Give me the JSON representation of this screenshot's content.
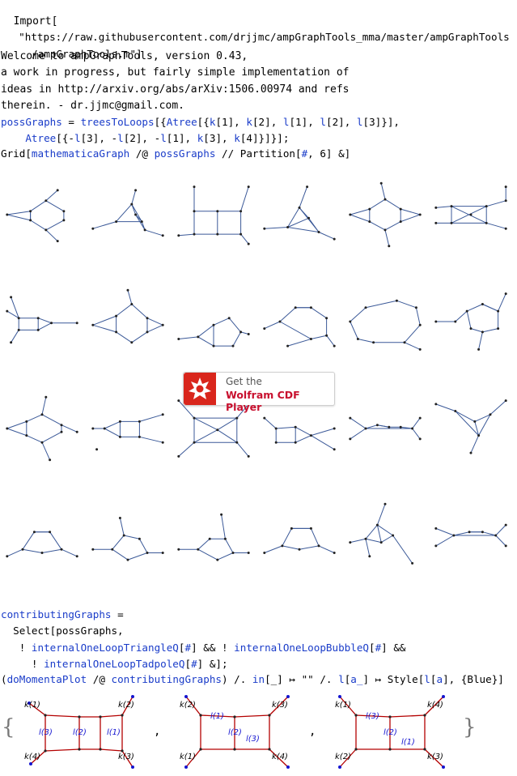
{
  "code": {
    "import_keyword": "Import[",
    "import_url_1": "\"https://raw.githubusercontent.com/drjjmc/ampGraphTools_mma/master/ampGraphTools",
    "import_url_2": "/ampGraphTools.m\"]",
    "welcome_1": "Welcome to ampGraphTools, version 0.43,",
    "welcome_2": "a work in progress, but fairly simple implementation of",
    "welcome_3": "ideas in http://arxiv.org/abs/arXiv:1506.00974 and refs",
    "welcome_4": "therein. - dr.jjmc@gmail.com.",
    "poss_1_a": "possGraphs",
    "poss_1_b": " = ",
    "poss_1_c": "treesToLoops",
    "poss_1_d": "[{",
    "poss_1_e": "Atree",
    "poss_1_f": "[{",
    "poss_1_g": "k",
    "poss_1_h": "[1], ",
    "poss_1_i": "k",
    "poss_1_j": "[2], ",
    "poss_1_k": "l",
    "poss_1_l": "[1], ",
    "poss_1_m": "l",
    "poss_1_n": "[2], ",
    "poss_1_o": "l",
    "poss_1_p": "[3]}],",
    "poss_2_a": "    Atree",
    "poss_2_b": "[{-",
    "poss_2_c": "l",
    "poss_2_d": "[3], -",
    "poss_2_e": "l",
    "poss_2_f": "[2], -",
    "poss_2_g": "l",
    "poss_2_h": "[1], ",
    "poss_2_i": "k",
    "poss_2_j": "[3], ",
    "poss_2_k": "k",
    "poss_2_l": "[4]}]}];",
    "grid_a": "Grid[",
    "grid_b": "mathematicaGraph",
    "grid_c": " /@ ",
    "grid_d": "possGraphs",
    "grid_e": " // Partition[",
    "grid_f": "#",
    "grid_g": ", 6] &]",
    "contrib_1_a": "contributingGraphs",
    "contrib_1_b": " =",
    "contrib_2": "  Select[possGraphs,",
    "contrib_3_a": "   ! ",
    "contrib_3_b": "internalOneLoopTriangleQ",
    "contrib_3_c": "[",
    "contrib_3_d": "#",
    "contrib_3_e": "] && ! ",
    "contrib_3_f": "internalOneLoopBubbleQ",
    "contrib_3_g": "[",
    "contrib_3_h": "#",
    "contrib_3_i": "] &&",
    "contrib_4_a": "     ! ",
    "contrib_4_b": "internalOneLoopTadpoleQ",
    "contrib_4_c": "[",
    "contrib_4_d": "#",
    "contrib_4_e": "] &];",
    "plot_a": "(",
    "plot_b": "doMomentaPlot",
    "plot_c": " /@ ",
    "plot_d": "contributingGraphs",
    "plot_e": ") /. ",
    "plot_f": "in",
    "plot_g": "[_] ↦ \"\" /. ",
    "plot_h": "l",
    "plot_i": "[",
    "plot_j": "a_",
    "plot_k": "] ↦ Style[",
    "plot_l": "l",
    "plot_m": "[",
    "plot_n": "a",
    "plot_o": "], {Blue}]"
  },
  "cdf_player": {
    "line1": "Get the",
    "line2": "Wolfram CDF Player"
  },
  "momenta_output": {
    "open_brace": "{",
    "close_brace": "}",
    "comma": ",",
    "plots": [
      {
        "k_labels": [
          "k(1)",
          "k(2)",
          "k(4)",
          "k(3)"
        ],
        "l_labels": [
          "l(3)",
          "l(2)",
          "l(1)"
        ]
      },
      {
        "k_labels": [
          "k(2)",
          "k(3)",
          "k(1)",
          "k(4)"
        ],
        "l_labels": [
          "l(1)",
          "l(2)",
          "l(3)"
        ]
      },
      {
        "k_labels": [
          "k(1)",
          "k(4)",
          "k(2)",
          "k(3)"
        ],
        "l_labels": [
          "l(3)",
          "l(2)",
          "l(1)"
        ]
      }
    ]
  },
  "colors": {
    "keyword_blue": "#1a3cc9",
    "graph_edge": "#3b5998",
    "momenta_edge": "#b40000",
    "label_blue": "#1515d0",
    "cdf_red": "#c8102e"
  }
}
